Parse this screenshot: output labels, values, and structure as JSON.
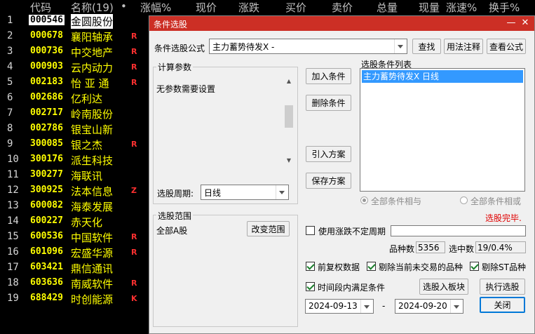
{
  "list_header": {
    "code": "代码",
    "name": "名称(19)",
    "dot": "•",
    "change_pct": "涨幅%",
    "price": "现价",
    "change": "涨跌",
    "bid": "买价",
    "ask": "卖价",
    "volume": "总量",
    "cur_volume": "现量",
    "speed": "涨速%",
    "turnover": "换手%"
  },
  "stocks": [
    {
      "idx": "1",
      "code": "000546",
      "name": "金圆股份",
      "flag": ""
    },
    {
      "idx": "2",
      "code": "000678",
      "name": "襄阳轴承",
      "flag": "R"
    },
    {
      "idx": "3",
      "code": "000736",
      "name": "中交地产",
      "flag": "R"
    },
    {
      "idx": "4",
      "code": "000903",
      "name": "云内动力",
      "flag": "R"
    },
    {
      "idx": "5",
      "code": "002183",
      "name": "怡 亚 通",
      "flag": "R"
    },
    {
      "idx": "6",
      "code": "002686",
      "name": "亿利达",
      "flag": ""
    },
    {
      "idx": "7",
      "code": "002717",
      "name": "岭南股份",
      "flag": ""
    },
    {
      "idx": "8",
      "code": "002786",
      "name": "银宝山新",
      "flag": ""
    },
    {
      "idx": "9",
      "code": "300085",
      "name": "银之杰",
      "flag": "R"
    },
    {
      "idx": "10",
      "code": "300176",
      "name": "派生科技",
      "flag": ""
    },
    {
      "idx": "11",
      "code": "300277",
      "name": "海联讯",
      "flag": ""
    },
    {
      "idx": "12",
      "code": "300925",
      "name": "法本信息",
      "flag": "Z"
    },
    {
      "idx": "13",
      "code": "600082",
      "name": "海泰发展",
      "flag": ""
    },
    {
      "idx": "14",
      "code": "600227",
      "name": "赤天化",
      "flag": ""
    },
    {
      "idx": "15",
      "code": "600536",
      "name": "中国软件",
      "flag": "R"
    },
    {
      "idx": "16",
      "code": "601096",
      "name": "宏盛华源",
      "flag": "R"
    },
    {
      "idx": "17",
      "code": "603421",
      "name": "鼎信通讯",
      "flag": ""
    },
    {
      "idx": "18",
      "code": "603636",
      "name": "南威软件",
      "flag": "R"
    },
    {
      "idx": "19",
      "code": "688429",
      "name": "时创能源",
      "flag": "K"
    }
  ],
  "dialog": {
    "title": "条件选股",
    "minimize": "—",
    "close": "✕",
    "formula_label": "条件选股公式",
    "formula_value": "主力蓄势待发X -",
    "find_btn": "查找",
    "usage_btn": "用法注释",
    "view_btn": "查看公式",
    "params_title": "计算参数",
    "params_text": "无参数需要设置",
    "period_label": "选股周期:",
    "period_value": "日线",
    "add_btn": "加入条件",
    "delete_btn": "删除条件",
    "import_btn": "引入方案",
    "save_btn": "保存方案",
    "list_title": "选股条件列表",
    "list_items": [
      "主力蓄势待发X  日线"
    ],
    "radio_and": "全部条件相与",
    "radio_or": "全部条件相或",
    "status": "选股完毕.",
    "range_title": "选股范围",
    "range_value": "全部A股",
    "change_range_btn": "改变范围",
    "use_uncertain": "使用涨跌不定周期",
    "count_label": "品种数",
    "count_value": "5356",
    "selected_label": "选中数",
    "selected_value": "19/0.4%",
    "prev_adj": "前复权数据",
    "exclude_untraded": "剔除当前未交易的品种",
    "exclude_st": "剔除ST品种",
    "period_satisfy": "时间段内满足条件",
    "to_block_btn": "选股入板块",
    "exec_btn": "执行选股",
    "date_from": "2024-09-13",
    "date_sep": "-",
    "date_to": "2024-09-20",
    "close_btn": "关闭"
  },
  "colors": {
    "title_bar": "#cc2f25",
    "code": "#ffff00",
    "flag": "#ff3030",
    "status": "#e00000",
    "list_select": "#3399ff"
  }
}
